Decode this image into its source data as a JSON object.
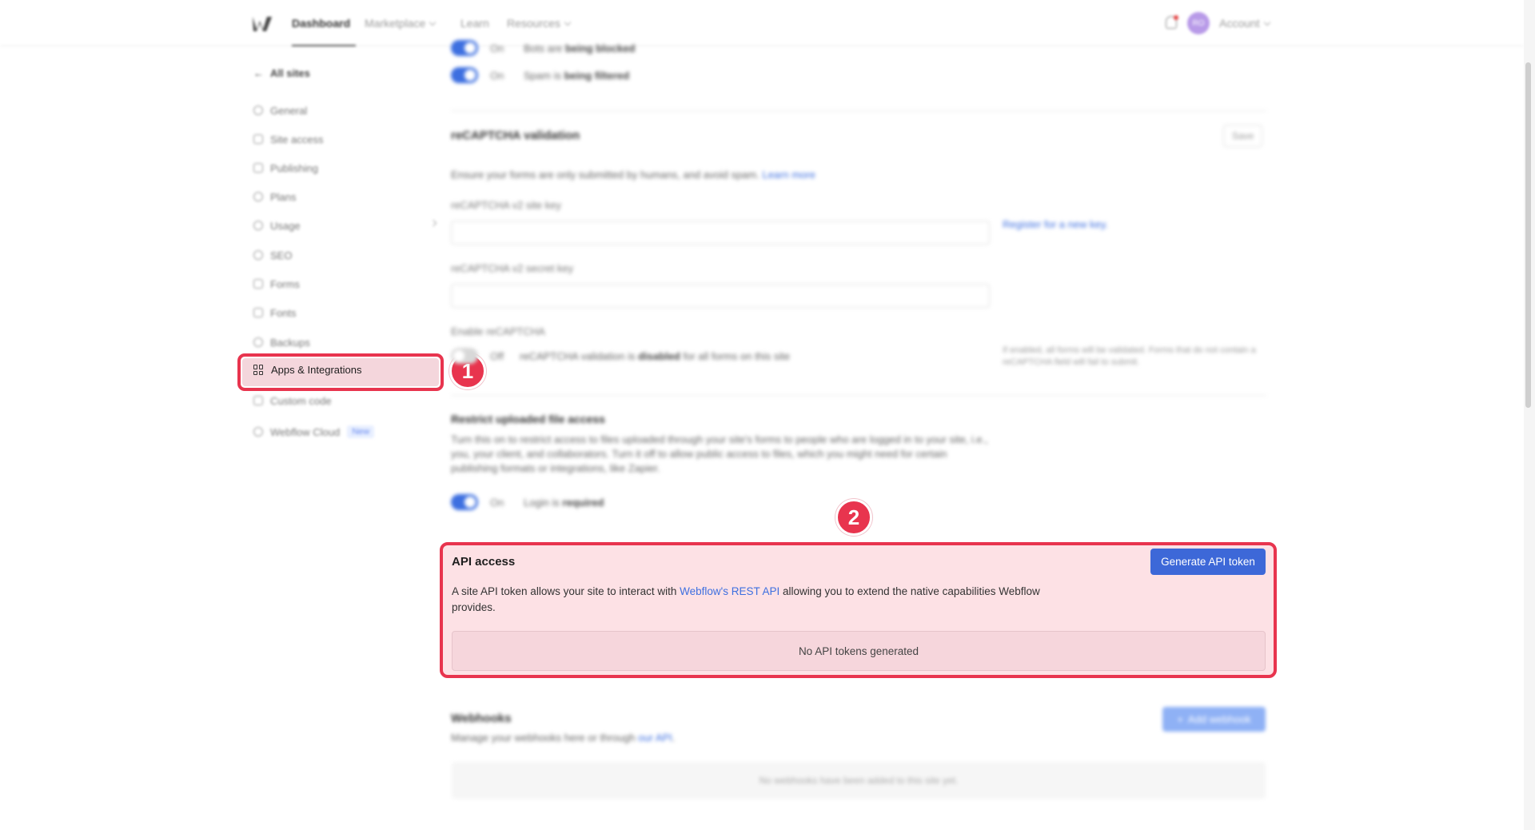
{
  "topbar": {
    "nav": [
      {
        "label": "Dashboard"
      },
      {
        "label": "Marketplace"
      },
      {
        "label": "Learn"
      },
      {
        "label": "Resources"
      }
    ],
    "avatar_initials": "RO",
    "account_label": "Account"
  },
  "sidebar": {
    "back_label": "All sites",
    "items": [
      {
        "label": "General"
      },
      {
        "label": "Site access"
      },
      {
        "label": "Publishing"
      },
      {
        "label": "Plans"
      },
      {
        "label": "Usage"
      },
      {
        "label": "SEO"
      },
      {
        "label": "Forms"
      },
      {
        "label": "Fonts"
      },
      {
        "label": "Backups"
      },
      {
        "label": "Apps & Integrations"
      },
      {
        "label": "Custom code"
      },
      {
        "label": "Webflow Cloud"
      }
    ],
    "new_badge": "New"
  },
  "annotations": {
    "badge1": "1",
    "badge2": "2"
  },
  "forms": {
    "toggle_on_label": "On",
    "toggle_off_label": "Off",
    "bots_text": "Bots are ",
    "bots_bold": "being blocked",
    "spam_text": "Spam is ",
    "spam_bold": "being filtered"
  },
  "recaptcha": {
    "title": "reCAPTCHA validation",
    "save_label": "Save",
    "description": "Ensure your forms are only submitted by humans, and avoid spam. ",
    "learn_more": "Learn more",
    "site_key_label": "reCAPTCHA v2 site key",
    "register_link": "Register for a new key.",
    "secret_key_label": "reCAPTCHA v2 secret key",
    "enable_label": "Enable reCAPTCHA",
    "status_text": "reCAPTCHA validation is ",
    "status_bold": "disabled",
    "status_suffix": " for all forms on this site",
    "note": "If enabled, all forms will be validated. Forms that do not contain a reCAPTCHA field will fail to submit."
  },
  "restrict": {
    "title": "Restrict uploaded file access",
    "description": "Turn this on to restrict access to files uploaded through your site's forms to people who are logged in to your site, i.e., you, your client, and collaborators. Turn it off to allow public access to files, which you might need for certain publishing formats or integrations, like Zapier.",
    "status_text": "Login is ",
    "status_bold": "required"
  },
  "api_access": {
    "title": "API access",
    "button_label": "Generate API token",
    "desc_prefix": "A site API token allows your site to interact with ",
    "desc_link": "Webflow's REST API",
    "desc_suffix": " allowing you to extend the native capabilities Webflow provides.",
    "empty_text": "No API tokens generated"
  },
  "webhooks": {
    "title": "Webhooks",
    "desc_prefix": "Manage your webhooks here or through ",
    "desc_link": "our API",
    "desc_suffix": ".",
    "add_label": "Add webhook",
    "empty_text": "No webhooks have been added to this site yet."
  },
  "colors": {
    "highlight": "#e8344e",
    "accent_blue": "#3d68d8",
    "highlight_fill": "#fde1e5"
  }
}
